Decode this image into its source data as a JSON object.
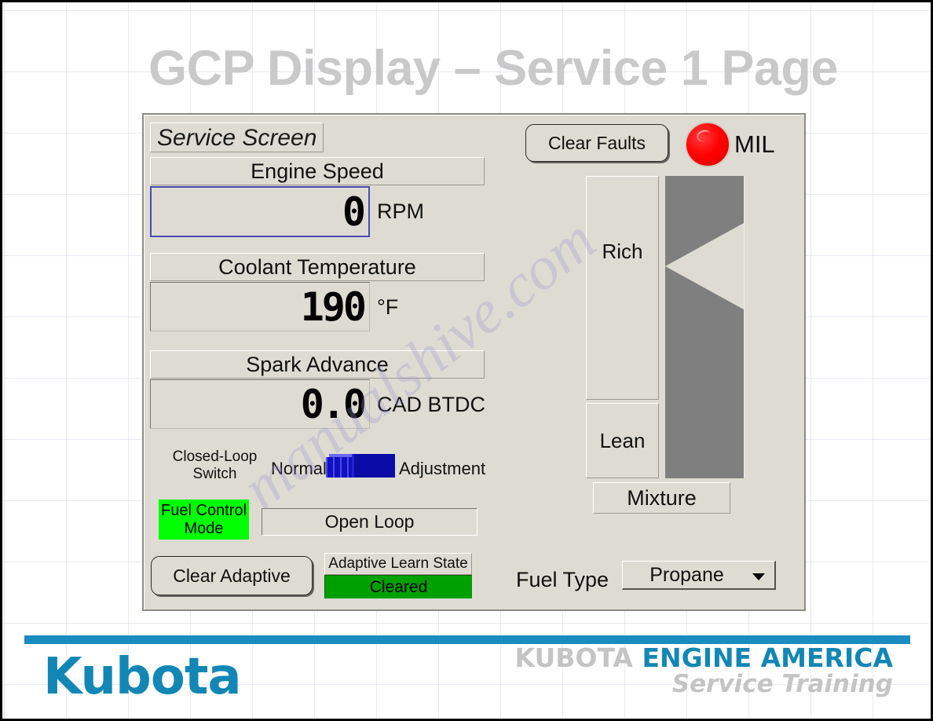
{
  "slide": {
    "title": "GCP Display – Service 1 Page",
    "watermark": "manualshive.com"
  },
  "panel": {
    "caption": "Service Screen",
    "gauges": [
      {
        "label": "Engine Speed",
        "value": "0",
        "unit": "RPM"
      },
      {
        "label": "Coolant Temperature",
        "value": "190",
        "unit": "°F"
      },
      {
        "label": "Spark Advance",
        "value": "0.0",
        "unit": "CAD BTDC"
      }
    ],
    "closed_loop": {
      "label_line1": "Closed-Loop",
      "label_line2": "Switch",
      "left_option": "Normal",
      "right_option": "Adjustment",
      "position": "Normal"
    },
    "fuel_control": {
      "label_line1": "Fuel Control",
      "label_line2": "Mode",
      "value": "Open Loop",
      "label_bg_color": "#00ff00"
    },
    "adaptive": {
      "clear_button": "Clear Adaptive",
      "state_label": "Adaptive Learn State",
      "state_value": "Cleared",
      "state_bg_color": "#00a000"
    },
    "faults": {
      "clear_button": "Clear Faults",
      "mil_label": "MIL",
      "mil_color": "#ff0000"
    },
    "mixture": {
      "rich_label": "Rich",
      "lean_label": "Lean",
      "title": "Mixture",
      "bar_color": "#7f7f7f"
    },
    "fuel_type": {
      "label": "Fuel Type",
      "selected": "Propane"
    }
  },
  "footer": {
    "brand": "Kubota",
    "org_prefix": "KUBOTA",
    "org_suffix": "ENGINE AMERICA",
    "tagline": "Service Training",
    "accent_color": "#1287b5"
  }
}
